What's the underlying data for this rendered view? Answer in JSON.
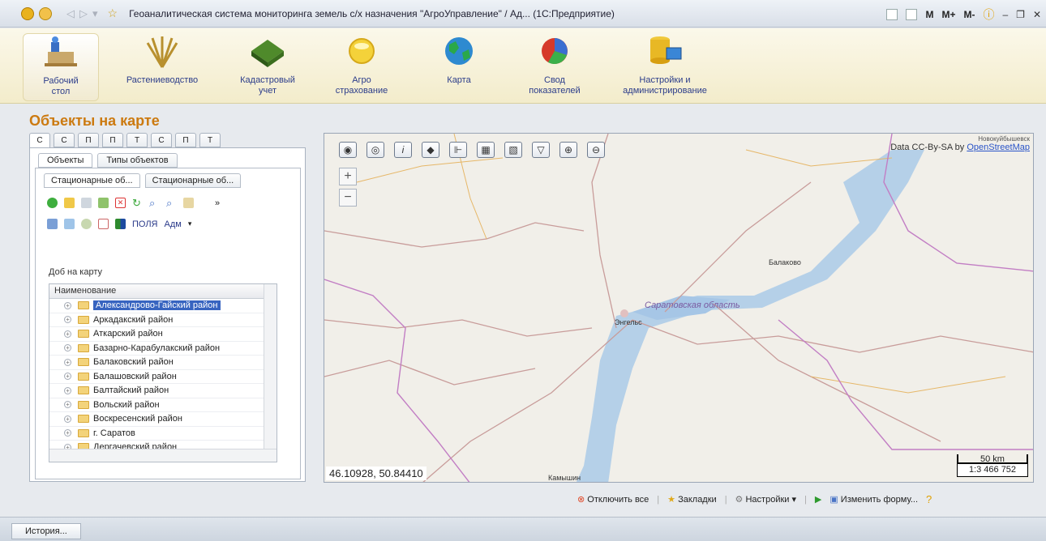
{
  "window": {
    "title": "Геоаналитическая система мониторинга земель с/х назначения \"АгроУправление\" / Ад... (1С:Предприятие)",
    "right_buttons": [
      "M",
      "M+",
      "M-"
    ]
  },
  "ribbon": {
    "items": [
      {
        "label": "Рабочий\nстол"
      },
      {
        "label": "Растениеводство"
      },
      {
        "label": "Кадастровый\nучет"
      },
      {
        "label": "Агро\nстрахование"
      },
      {
        "label": "Карта"
      },
      {
        "label": "Свод\nпоказателей"
      },
      {
        "label": "Настройки и\nадминистрирование"
      }
    ]
  },
  "page_title": "Объекты на карте",
  "left_panel": {
    "top_tabs": [
      "С",
      "С",
      "П",
      "П",
      "Т",
      "С",
      "П",
      "Т"
    ],
    "tabs": [
      "Объекты",
      "Типы объектов"
    ],
    "subtabs": [
      "Стационарные об...",
      "Стационарные об..."
    ],
    "toolbar_text": [
      "ПОЛЯ",
      "Адм"
    ],
    "add_to_map": "Доб на карту",
    "grid_header": "Наименование",
    "rows": [
      "Александрово-Гайский район",
      "Аркадакский район",
      "Аткарский район",
      "Базарно-Карабулакский район",
      "Балаковский район",
      "Балашовский район",
      "Балтайский район",
      "Вольский район",
      "Воскресенский район",
      "г. Саратов",
      "Дергачевский район"
    ]
  },
  "map": {
    "attribution_prefix": "Data CC-By-SA by ",
    "attribution_link": "OpenStreetMap",
    "top_label": "Новокуйбышевск",
    "region_label": "Саратовская область",
    "city_labels": [
      "Балаково",
      "Энгельс",
      "Камышин"
    ],
    "coords": "46.10928, 50.84410",
    "scale_km": "50 km",
    "scale_ratio": "1:3 466 752",
    "zoom_in": "+",
    "zoom_out": "−"
  },
  "bottom_bar": {
    "disable_all": "Отключить все",
    "bookmarks": "Закладки",
    "settings": "Настройки",
    "change_form": "Изменить форму..."
  },
  "footer": {
    "history": "История..."
  }
}
